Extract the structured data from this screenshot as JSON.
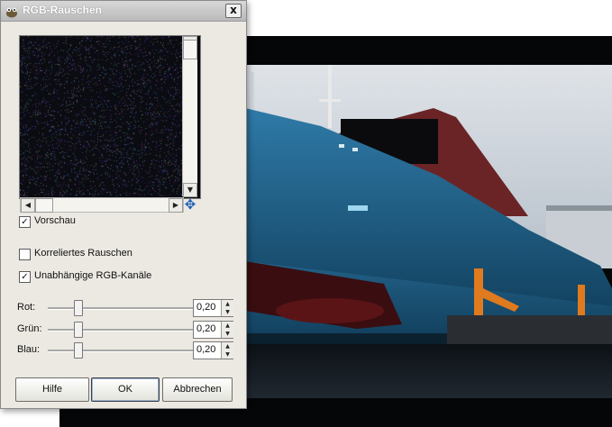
{
  "dialog": {
    "title": "RGB-Rauschen",
    "close_label": "x",
    "preview_label": "Vorschau",
    "preview_checked": true,
    "options": [
      {
        "label": "Korreliertes Rauschen",
        "checked": false
      },
      {
        "label": "Unabhängige RGB-Kanäle",
        "checked": true
      }
    ],
    "sliders": [
      {
        "label": "Rot:",
        "value": "0,20",
        "level": 0.2
      },
      {
        "label": "Grün:",
        "value": "0,20",
        "level": 0.2
      },
      {
        "label": "Blau:",
        "value": "0,20",
        "level": 0.2
      }
    ],
    "buttons": {
      "help": "Hilfe",
      "ok": "OK",
      "cancel": "Abbrechen"
    }
  },
  "colors": {
    "dialog_bg": "#ece9e2",
    "hull_blue": "#1f5f86",
    "hull_red": "#5a1416",
    "crane_orange": "#e07a1f"
  },
  "icons": {
    "title": "gimp-wilber-icon",
    "navigate": "navigate-cross-icon"
  }
}
